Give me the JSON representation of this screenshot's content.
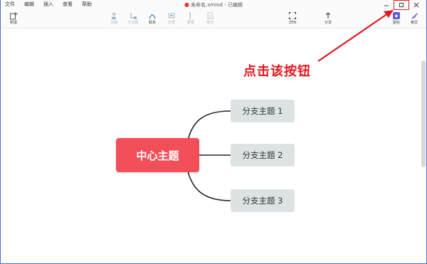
{
  "menu": {
    "file": "文件",
    "edit": "编辑",
    "insert": "插入",
    "view": "查看",
    "help": "帮助"
  },
  "document": {
    "title": "未命名.xmind - 已编辑"
  },
  "toolbar": {
    "new": "新建",
    "topic": "主题",
    "subtopic": "子主题",
    "relationship": "联系",
    "summary": "外框",
    "boundary": "概要",
    "note": "笔记",
    "zen": "ZEN",
    "share": "分享",
    "icon": "图标",
    "format": "格式"
  },
  "mindmap": {
    "central_topic": "中心主题",
    "branches": [
      "分支主题 1",
      "分支主题 2",
      "分支主题 3"
    ]
  },
  "annotation": {
    "text": "点击该按钮",
    "color": "#e3171f"
  },
  "colors": {
    "central_topic": "#f24f5b",
    "branch_topic": "#dde2e4",
    "highlight": "#e02020"
  }
}
